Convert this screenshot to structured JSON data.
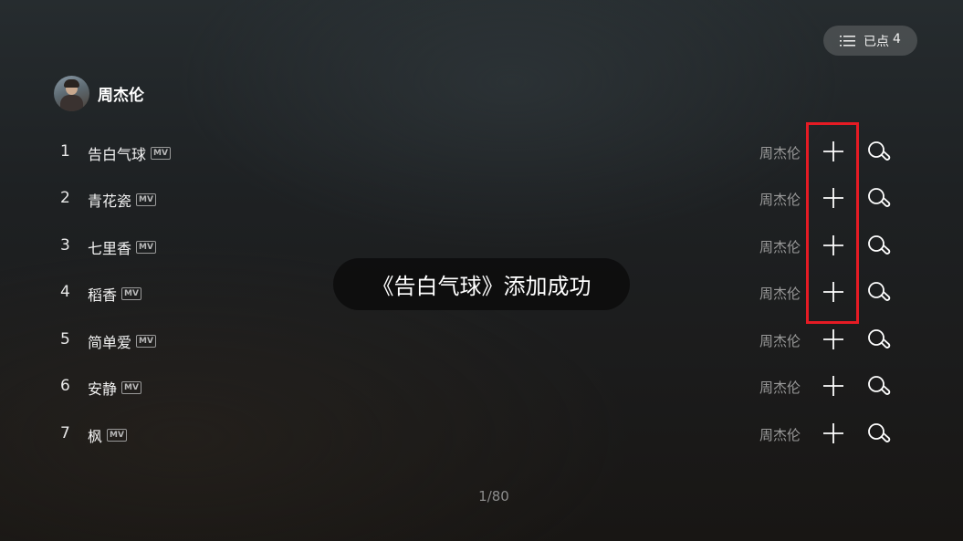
{
  "queue": {
    "icon": "list-icon",
    "label": "已点",
    "count": "4"
  },
  "singer": {
    "name": "周杰伦"
  },
  "songs": [
    {
      "index": "1",
      "title": "告白气球",
      "badge": "MV",
      "artist": "周杰伦"
    },
    {
      "index": "2",
      "title": "青花瓷",
      "badge": "MV",
      "artist": "周杰伦"
    },
    {
      "index": "3",
      "title": "七里香",
      "badge": "MV",
      "artist": "周杰伦"
    },
    {
      "index": "4",
      "title": "稻香",
      "badge": "MV",
      "artist": "周杰伦"
    },
    {
      "index": "5",
      "title": "简单爱",
      "badge": "MV",
      "artist": "周杰伦"
    },
    {
      "index": "6",
      "title": "安静",
      "badge": "MV",
      "artist": "周杰伦"
    },
    {
      "index": "7",
      "title": "枫",
      "badge": "MV",
      "artist": "周杰伦"
    }
  ],
  "row_icons": {
    "add": "plus-icon",
    "search": "search-icon"
  },
  "toast": {
    "message": "《告白气球》添加成功"
  },
  "pagination": {
    "text": "1/80"
  },
  "colors": {
    "highlight": "#e51b24",
    "artist_text": "#9a9a9a",
    "badge_border": "#9a9a9a"
  }
}
